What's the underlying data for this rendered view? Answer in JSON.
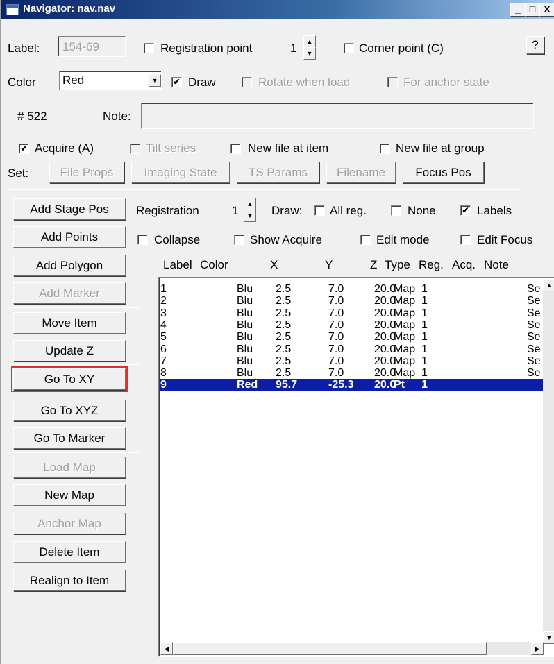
{
  "window": {
    "title": "Navigator: nav.nav",
    "min": "_",
    "max": "□",
    "close": "X"
  },
  "top": {
    "label_caption": "Label:",
    "label_value": "154-69",
    "registration_point": "Registration point",
    "reg_point_value": "1",
    "corner_point": "Corner point (C)",
    "help": "?",
    "color_caption": "Color",
    "color_value": "Red",
    "draw": "Draw",
    "rotate_when_load": "Rotate when load",
    "for_anchor_state": "For anchor state",
    "item_number": "# 522",
    "note_caption": "Note:",
    "note_value": "",
    "acquire": "Acquire (A)",
    "tilt_series": "Tilt series",
    "new_file_at_item": "New file at item",
    "new_file_at_group": "New file at group",
    "set_caption": "Set:",
    "file_props": "File Props",
    "imaging_state": "Imaging State",
    "ts_params": "TS Params",
    "filename": "Filename",
    "focus_pos": "Focus Pos"
  },
  "left_buttons": {
    "add_stage_pos": "Add Stage Pos",
    "add_points": "Add Points",
    "add_polygon": "Add Polygon",
    "add_marker": "Add Marker",
    "move_item": "Move Item",
    "update_z": "Update Z",
    "go_to_xy": "Go To XY",
    "go_to_xyz": "Go To XYZ",
    "go_to_marker": "Go To Marker",
    "load_map": "Load Map",
    "new_map": "New Map",
    "anchor_map": "Anchor Map",
    "delete_item": "Delete Item",
    "realign_to_item": "Realign to Item"
  },
  "options": {
    "registration": "Registration",
    "registration_value": "1",
    "draw_caption": "Draw:",
    "all_reg": "All reg.",
    "none": "None",
    "labels": "Labels",
    "collapse": "Collapse",
    "show_acquire": "Show Acquire",
    "edit_mode": "Edit mode",
    "edit_focus": "Edit Focus"
  },
  "columns": {
    "label": "Label",
    "color": "Color",
    "x": "X",
    "y": "Y",
    "z": "Z",
    "type": "Type",
    "reg": "Reg.",
    "acq": "Acq.",
    "note": "Note"
  },
  "rows": [
    {
      "label": "1",
      "color": "Blu",
      "x": "2.5",
      "y": "7.0",
      "z": "20.0",
      "type": "Map",
      "reg": "1",
      "note": "Se"
    },
    {
      "label": "2",
      "color": "Blu",
      "x": "2.5",
      "y": "7.0",
      "z": "20.0",
      "type": "Map",
      "reg": "1",
      "note": "Se"
    },
    {
      "label": "3",
      "color": "Blu",
      "x": "2.5",
      "y": "7.0",
      "z": "20.0",
      "type": "Map",
      "reg": "1",
      "note": "Se"
    },
    {
      "label": "4",
      "color": "Blu",
      "x": "2.5",
      "y": "7.0",
      "z": "20.0",
      "type": "Map",
      "reg": "1",
      "note": "Se"
    },
    {
      "label": "5",
      "color": "Blu",
      "x": "2.5",
      "y": "7.0",
      "z": "20.0",
      "type": "Map",
      "reg": "1",
      "note": "Se"
    },
    {
      "label": "6",
      "color": "Blu",
      "x": "2.5",
      "y": "7.0",
      "z": "20.0",
      "type": "Map",
      "reg": "1",
      "note": "Se"
    },
    {
      "label": "7",
      "color": "Blu",
      "x": "2.5",
      "y": "7.0",
      "z": "20.0",
      "type": "Map",
      "reg": "1",
      "note": "Se"
    },
    {
      "label": "8",
      "color": "Blu",
      "x": "2.5",
      "y": "7.0",
      "z": "20.0",
      "type": "Map",
      "reg": "1",
      "note": "Se"
    },
    {
      "label": "9",
      "color": "Red",
      "x": "95.7",
      "y": "-25.3",
      "z": "20.0",
      "type": "Pt",
      "reg": "1",
      "note": ""
    }
  ],
  "colors": {
    "selection": "#0a1eaa",
    "focus_outline": "#e03030",
    "title_start": "#0a246a"
  }
}
